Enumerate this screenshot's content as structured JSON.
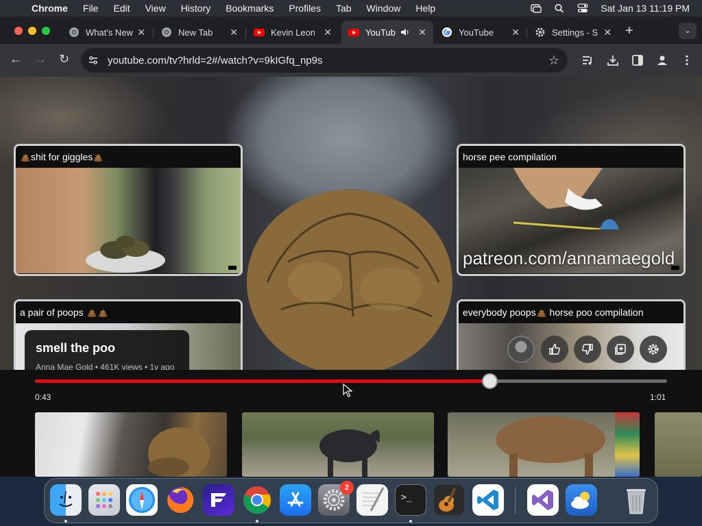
{
  "menubar": {
    "app": "Chrome",
    "items": [
      "File",
      "Edit",
      "View",
      "History",
      "Bookmarks",
      "Profiles",
      "Tab",
      "Window",
      "Help"
    ],
    "datetime": "Sat Jan 13  11:19 PM"
  },
  "tabs": [
    {
      "label": "What's New",
      "icon": "chrome-icon"
    },
    {
      "label": "New Tab",
      "icon": "chrome-icon"
    },
    {
      "label": "Kevin Leonard",
      "icon": "youtube-icon"
    },
    {
      "label": "YouTube",
      "icon": "youtube-icon",
      "active": true,
      "audio": true
    },
    {
      "label": "YouTube",
      "icon": "google-icon"
    },
    {
      "label": "Settings - S",
      "icon": "gear-icon"
    }
  ],
  "address_bar": {
    "url": "youtube.com/tv?hrld=2#/watch?v=9kIGfq_np9s"
  },
  "player": {
    "watermark": "patreon.com/annamaegold",
    "info": {
      "title": "smell the poo",
      "meta": "Anna Mae Gold • 461K views • 1y ago"
    },
    "time_current": "0:43",
    "time_total": "1:01",
    "progress": 0.72
  },
  "suggestions": [
    {
      "title": "shit for giggles",
      "emoji_before": 1,
      "emoji_after": 1
    },
    {
      "title": "horse pee compilation",
      "emoji_before": 0,
      "emoji_after": 0
    },
    {
      "title": "a pair of poops",
      "emoji_before": 0,
      "emoji_after": 2
    },
    {
      "title": "everybody poops",
      "title_2": " horse poo compilation",
      "emoji_before": 0,
      "emoji_after": 0
    }
  ],
  "dock": {
    "settings_badge": "2"
  },
  "colors": {
    "accent": "#e50914",
    "youtube": "#ff0000"
  }
}
